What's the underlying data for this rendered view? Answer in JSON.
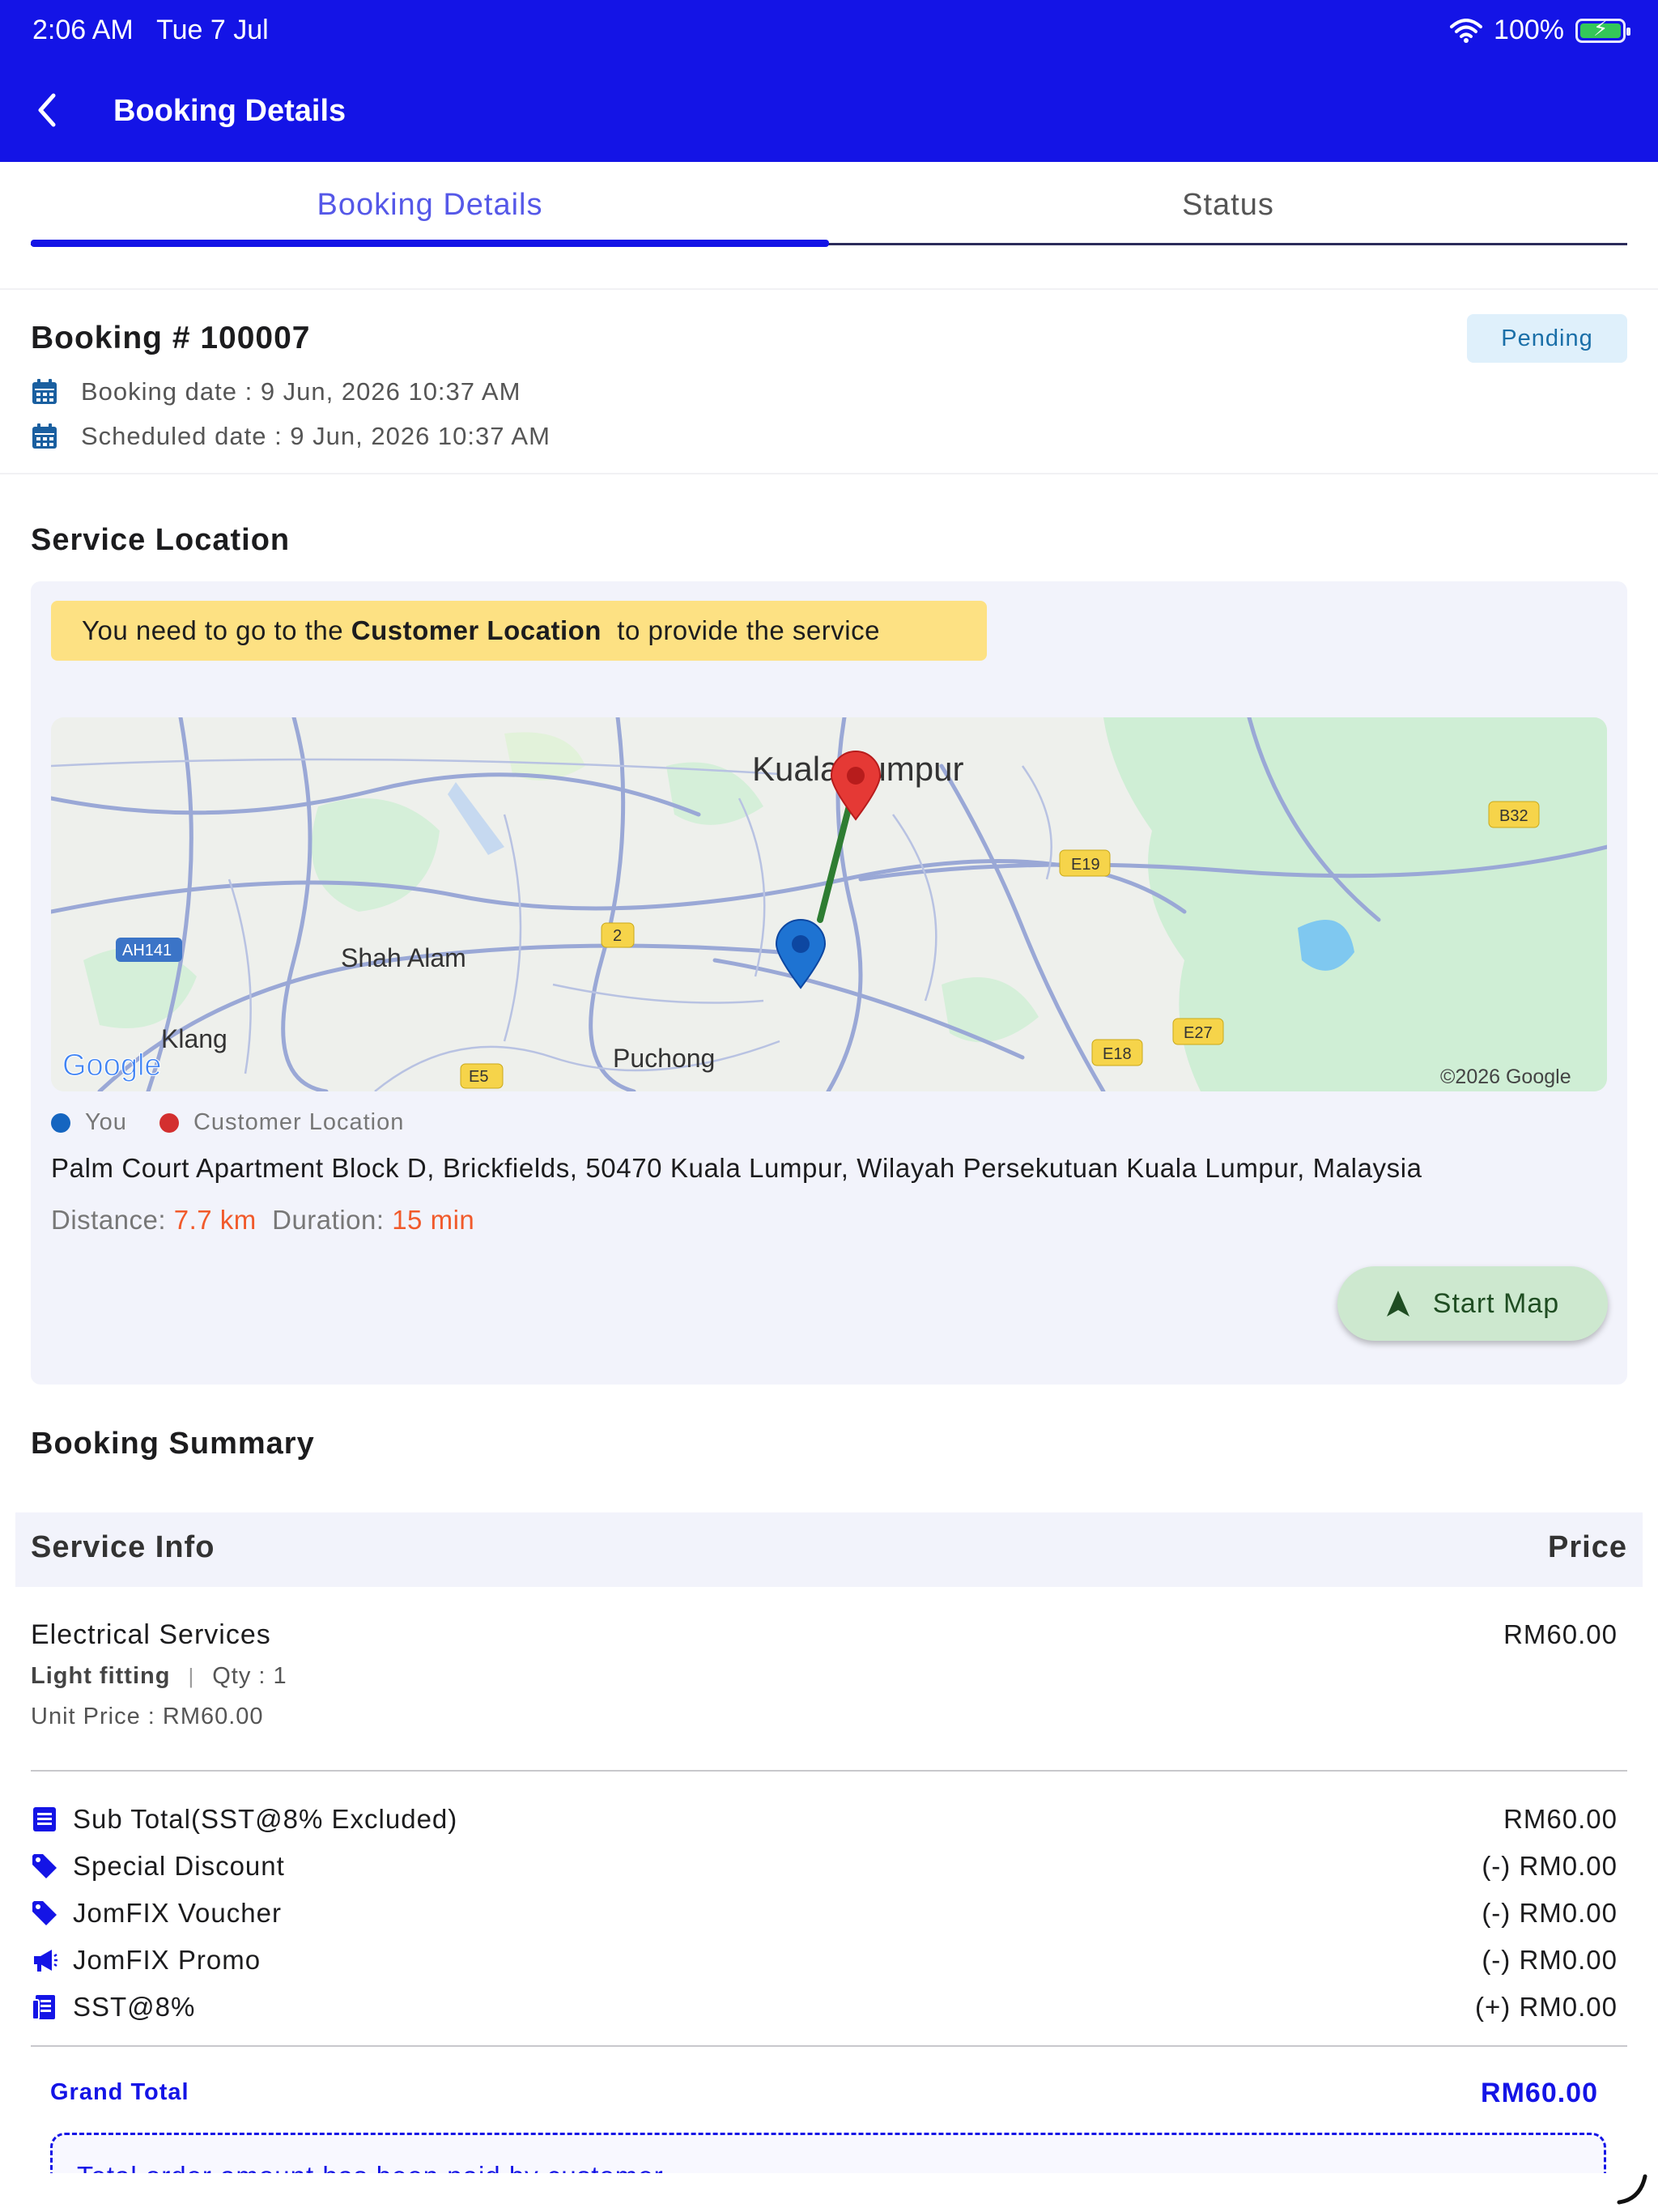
{
  "status_bar": {
    "time": "2:06 AM",
    "date": "Tue 7 Jul",
    "battery": "100%"
  },
  "app_bar": {
    "title": "Booking Details"
  },
  "tabs": [
    {
      "label": "Booking Details"
    },
    {
      "label": "Status"
    }
  ],
  "booking": {
    "title": "Booking # 100007",
    "status": "Pending",
    "booking_date": "Booking date : 9 Jun, 2026 10:37 AM",
    "scheduled_date": "Scheduled date :  9 Jun, 2026 10:37 AM"
  },
  "service_location": {
    "heading": "Service Location",
    "notice_pre": "You need to go to the ",
    "notice_bold": "Customer Location",
    "notice_post": "  to provide the service",
    "map": {
      "labels": [
        "Kuala Lumpur",
        "Shah Alam",
        "Klang",
        "Puchong"
      ],
      "road_badges": [
        "B32",
        "E19",
        "2",
        "AH141",
        "E27",
        "E18",
        "E5"
      ],
      "logo": "Google",
      "copyright": "©2026 Google"
    },
    "legend": {
      "you": "You",
      "customer": "Customer Location"
    },
    "address": "Palm Court Apartment Block D, Brickfields, 50470 Kuala Lumpur, Wilayah Persekutuan Kuala Lumpur, Malaysia",
    "distance_label": "Distance: ",
    "distance_value": "7.7 km",
    "duration_label": "  Duration: ",
    "duration_value": "15 min",
    "start_map_label": "Start Map"
  },
  "summary": {
    "heading": "Booking Summary",
    "col_service": "Service Info",
    "col_price": "Price",
    "item": {
      "name": "Electrical Services",
      "price": "RM60.00",
      "variant": "Light fitting",
      "sep": "|",
      "qty": "Qty : 1",
      "unit_price": "Unit Price : RM60.00"
    },
    "rows": [
      {
        "icon": "receipt-icon",
        "label": "Sub Total(SST@8% Excluded)",
        "amount": "RM60.00"
      },
      {
        "icon": "tag-icon",
        "label": "Special Discount",
        "amount": "(-) RM0.00"
      },
      {
        "icon": "tag-icon",
        "label": "JomFIX Voucher",
        "amount": "(-) RM0.00"
      },
      {
        "icon": "megaphone-icon",
        "label": "JomFIX Promo",
        "amount": "(-) RM0.00"
      },
      {
        "icon": "tax-receipt-icon",
        "label": "SST@8%",
        "amount": "(+) RM0.00"
      }
    ],
    "grand_total_label": "Grand Total",
    "grand_total_value": "RM60.00",
    "paid_note": "Total order amount has been paid by customer"
  },
  "colors": {
    "primary": "#1414e6",
    "tab_active_text": "#5558e8",
    "pending_bg": "#dff0fb",
    "pending_text": "#1a6fa8",
    "notice_bg": "#fde183",
    "highlight": "#f15a2b",
    "start_map_bg": "#cde8cf",
    "marker_you": "#1565c0",
    "marker_customer": "#d32f2f",
    "route": "#2e7d32"
  }
}
